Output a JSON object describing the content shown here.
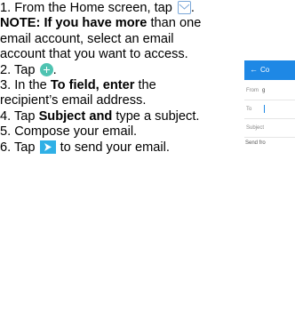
{
  "instructions": {
    "step1_pre": "1. From the Home screen, tap",
    "step1_post": ".",
    "note_bold": "NOTE: If you have more",
    "note_rest": "than one email account, select an email account that you want to access.",
    "step2_pre": "2. Tap",
    "step2_post": ".",
    "step3_pre": "3. In the",
    "step3_bold": "To field, enter",
    "step3_rest": "the recipient’s email address.",
    "step4_pre": "4. Tap",
    "step4_bold": "Subject and",
    "step4_rest": "type a subject.",
    "step5": "5. Compose your email.",
    "step6_pre": "6. Tap",
    "step6_post": "to send your email."
  },
  "icons": {
    "email_app": "envelope-icon",
    "compose": "plus-icon",
    "send": "send-arrow-icon",
    "accent_teal": "#4fc3b1",
    "accent_blue": "#2fb0e6"
  },
  "phone_screenshot": {
    "title": "Co",
    "from_label": "From",
    "from_value": "g",
    "to_label": "To",
    "subject_label": "Subject",
    "send_from": "Send fro",
    "appbar_color": "#1e88e5"
  }
}
